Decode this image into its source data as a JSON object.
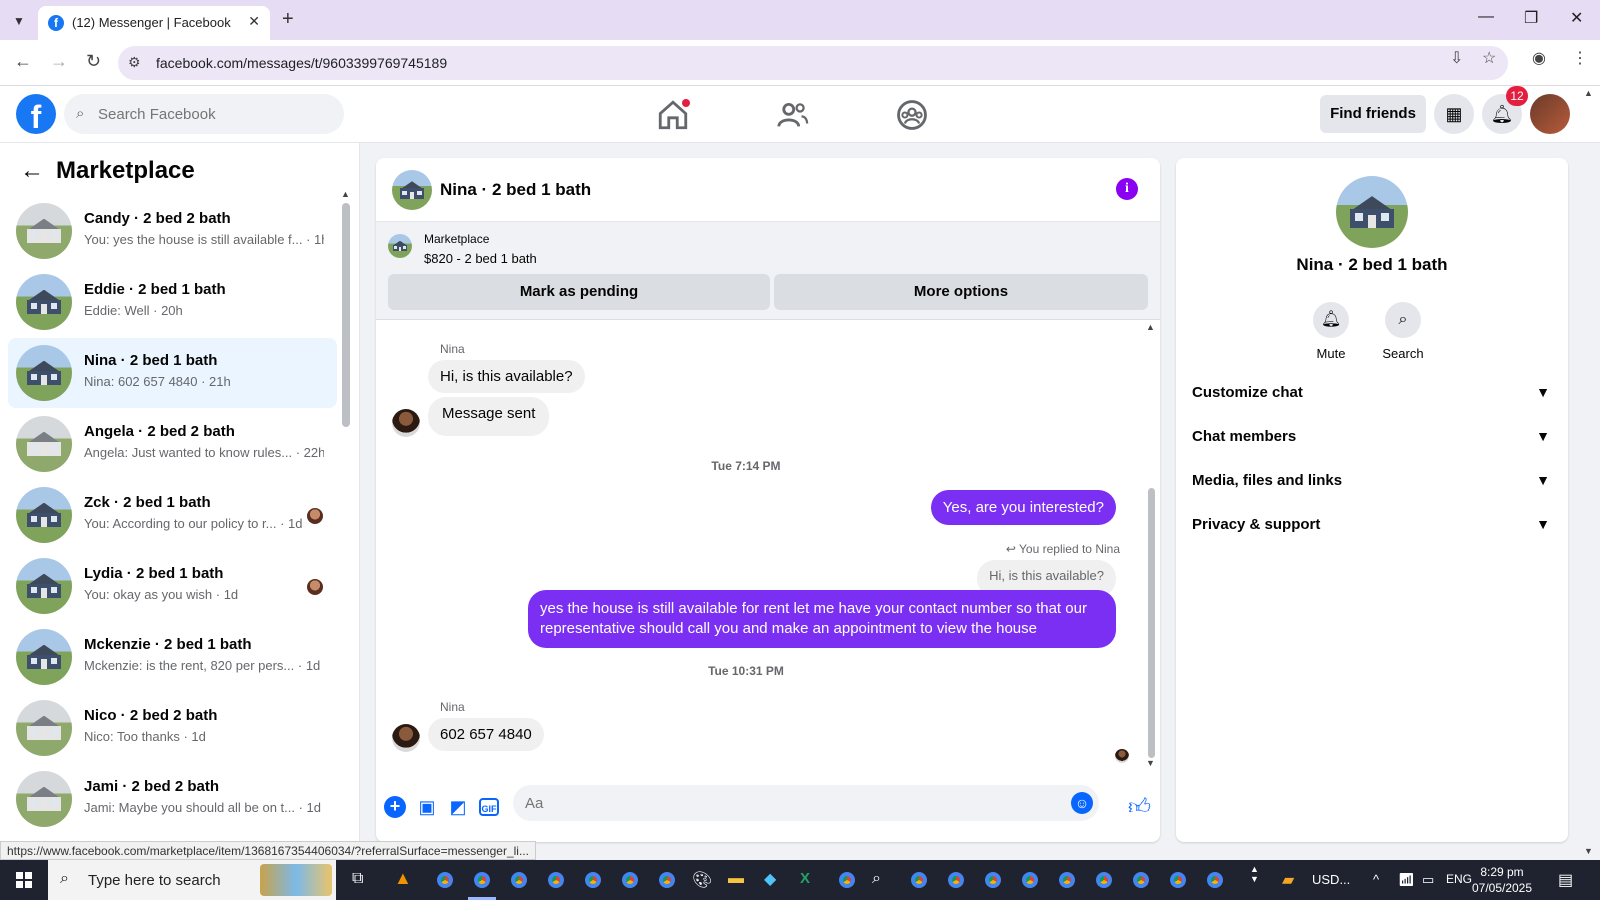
{
  "browser": {
    "tab_title": "(12) Messenger | Facebook",
    "url": "facebook.com/messages/t/9603399769745189",
    "status_url": "https://www.facebook.com/marketplace/item/1368167354406034/?referralSurface=messenger_li..."
  },
  "fb": {
    "search_placeholder": "Search Facebook",
    "find_friends": "Find friends",
    "notification_count": "12"
  },
  "left": {
    "title": "Marketplace",
    "conversations": [
      {
        "name": "Candy · 2 bed 2 bath",
        "snippet": "You: yes the house is still available f... · 1h"
      },
      {
        "name": "Eddie · 2 bed 1 bath",
        "snippet": "Eddie: Well · 20h"
      },
      {
        "name": "Nina · 2 bed 1 bath",
        "snippet": "Nina: 602 657 4840 · 21h"
      },
      {
        "name": "Angela · 2 bed 2 bath",
        "snippet": "Angela: Just wanted to know rules... · 22h"
      },
      {
        "name": "Zck · 2 bed 1 bath",
        "snippet": "You: According to our policy to r... · 1d"
      },
      {
        "name": "Lydia · 2 bed 1 bath",
        "snippet": "You: okay as you wish · 1d"
      },
      {
        "name": "Mckenzie · 2 bed 1 bath",
        "snippet": "Mckenzie: is the rent, 820 per pers... · 1d"
      },
      {
        "name": "Nico · 2 bed 2 bath",
        "snippet": "Nico: Too thanks · 1d"
      },
      {
        "name": "Jami · 2 bed 2 bath",
        "snippet": "Jami: Maybe you should all be on t... · 1d"
      }
    ]
  },
  "chat": {
    "title": "Nina · 2 bed 1 bath",
    "marketplace_label": "Marketplace",
    "listing": "$820 - 2 bed 1 bath",
    "mark_pending": "Mark as pending",
    "more_options": "More options",
    "sender_1": "Nina",
    "msg_1": "Hi, is this available?",
    "msg_2": "Message sent",
    "time_1": "Tue 7:14 PM",
    "out_1": "Yes, are you interested?",
    "replied_to": "You replied to Nina",
    "replied_quote": "Hi, is this available?",
    "out_2": "yes the house is still available for rent let me have your contact number so that our representative should call you and make an appointment to view the house",
    "time_2": "Tue 10:31 PM",
    "sender_2": "Nina",
    "msg_3": "602 657 4840",
    "composer_placeholder": "Aa"
  },
  "right": {
    "name": "Nina · 2 bed 1 bath",
    "mute": "Mute",
    "search": "Search",
    "sections": [
      "Customize chat",
      "Chat members",
      "Media, files and links",
      "Privacy & support"
    ]
  },
  "taskbar": {
    "search_placeholder": "Type here to search",
    "currency": "USD...",
    "lang": "ENG",
    "time": "8:29 pm",
    "date": "07/05/2025"
  },
  "colors": {
    "accent": "#1877f2",
    "outgoing_bubble": "#7b2ff2",
    "active_conv": "#ebf5ff"
  }
}
